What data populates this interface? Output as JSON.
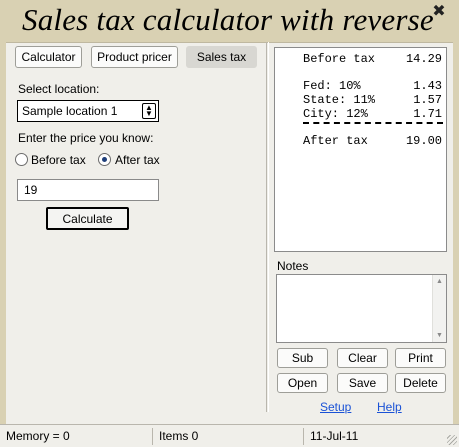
{
  "window": {
    "title": "Sales tax calculator with reverse",
    "close_glyph": "✖"
  },
  "tabs": [
    {
      "label": "Calculator"
    },
    {
      "label": "Product pricer"
    },
    {
      "label": "Sales tax",
      "active": true
    }
  ],
  "form": {
    "location_label": "Select location:",
    "location_value": "Sample location 1",
    "price_prompt": "Enter the price you know:",
    "radio_before": "Before tax",
    "radio_after": "After tax",
    "selected_radio": "after",
    "price_value": "19",
    "calculate_label": "Calculate"
  },
  "receipt": {
    "before_tax_label": "Before tax",
    "before_tax_value": "14.29",
    "fed_label": "Fed: 10%",
    "fed_value": "1.43",
    "state_label": "State: 11%",
    "state_value": "1.57",
    "city_label": "City: 12%",
    "city_value": "1.71",
    "after_tax_label": "After tax",
    "after_tax_value": "19.00"
  },
  "notes": {
    "label": "Notes",
    "value": ""
  },
  "actions": {
    "sub": "Sub",
    "clear": "Clear",
    "print": "Print",
    "open": "Open",
    "save": "Save",
    "delete": "Delete"
  },
  "links": {
    "setup": "Setup",
    "help": "Help"
  },
  "status": {
    "memory": "Memory = 0",
    "items": "Items 0",
    "date": "11-Jul-11"
  },
  "icons": {
    "close": "close-icon",
    "select_arrow": "up-down-arrows-icon",
    "scroll_up": "scroll-up-arrow-icon",
    "scroll_down": "scroll-down-arrow-icon",
    "resize_grip": "resize-grip-icon"
  }
}
